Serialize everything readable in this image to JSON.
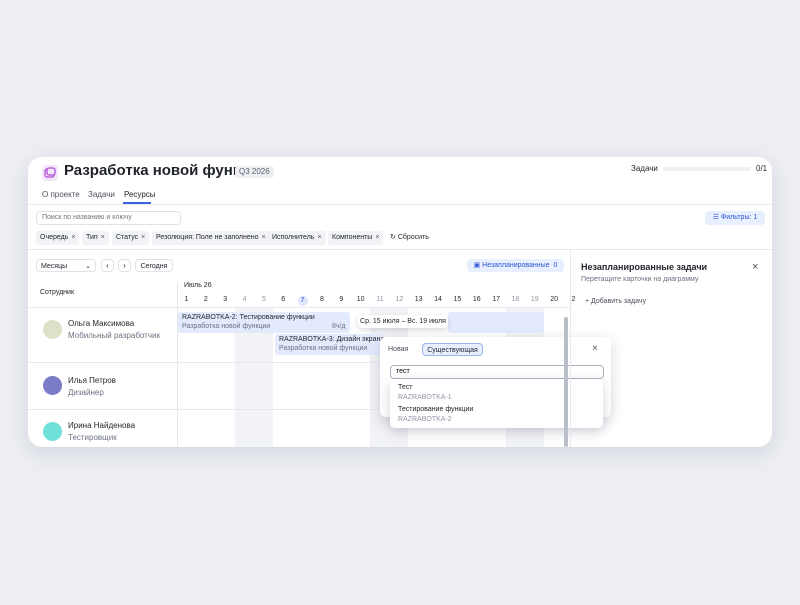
{
  "project": {
    "title": "Разработка новой функции",
    "quarter": "Q3 2026"
  },
  "tasks_progress": {
    "label": "Задачи",
    "count": "0/1",
    "fraction": 0
  },
  "tabs": [
    {
      "label": "О проекте"
    },
    {
      "label": "Задачи"
    },
    {
      "label": "Ресурсы",
      "active": true
    }
  ],
  "search": {
    "placeholder": "Поиск по названию и ключу"
  },
  "filters_button": "Фильтры: 1",
  "chips": [
    "Очередь",
    "Тип",
    "Статус",
    "Резолюция: Поле не заполнено",
    "Исполнитель",
    "Компоненты"
  ],
  "reset_label": "Сбросить",
  "toolbar": {
    "scale": "Месяцы",
    "prev": "‹",
    "next": "›",
    "today": "Сегодня",
    "unplanned_label": "Незапланированные",
    "unplanned_count": "0"
  },
  "timeline": {
    "column_header": "Сотрудник",
    "month": "Июль 26",
    "days": [
      "1",
      "2",
      "3",
      "4",
      "5",
      "6",
      "7",
      "8",
      "9",
      "10",
      "11",
      "12",
      "13",
      "14",
      "15",
      "16",
      "17",
      "18",
      "19",
      "20",
      "2"
    ],
    "current_day": "7"
  },
  "employees": [
    {
      "name": "Ольга Максимова",
      "role": "Мобильный разработчик",
      "color": "#dbe2c8"
    },
    {
      "name": "Илья Петров",
      "role": "Дизайнер",
      "color": "#7b7bc8"
    },
    {
      "name": "Ирина Найденова",
      "role": "Тестировщик",
      "color": "#6fe0d8"
    }
  ],
  "bars": [
    {
      "key": "RAZRABOTKA-2: Тестирование функции",
      "project": "Разработка новой функции",
      "hours": "8ч/д"
    },
    {
      "key": "RAZRABOTKA-3: Дизайн экрана",
      "project": "Разработка новой функции"
    }
  ],
  "tooltip": "Ср. 15 июля – Вс. 19 июля",
  "popup": {
    "tab_new": "Новая",
    "tab_existing": "Существующая",
    "input_value": "тест",
    "close": "×"
  },
  "suggestions": [
    {
      "title": "Тест",
      "key": "RAZRABOTKA-1"
    },
    {
      "title": "Тестирование функции",
      "key": "RAZRABOTKA-2"
    }
  ],
  "unplanned_panel": {
    "title": "Незапланированные задачи",
    "subtitle": "Перетащите карточки на диаграмму",
    "add_label": "Добавить задачу",
    "close": "×"
  },
  "colors": {
    "accent": "#3a64e0",
    "bar_fill": "#e3eafe",
    "weekend": "#f2f3f6"
  }
}
